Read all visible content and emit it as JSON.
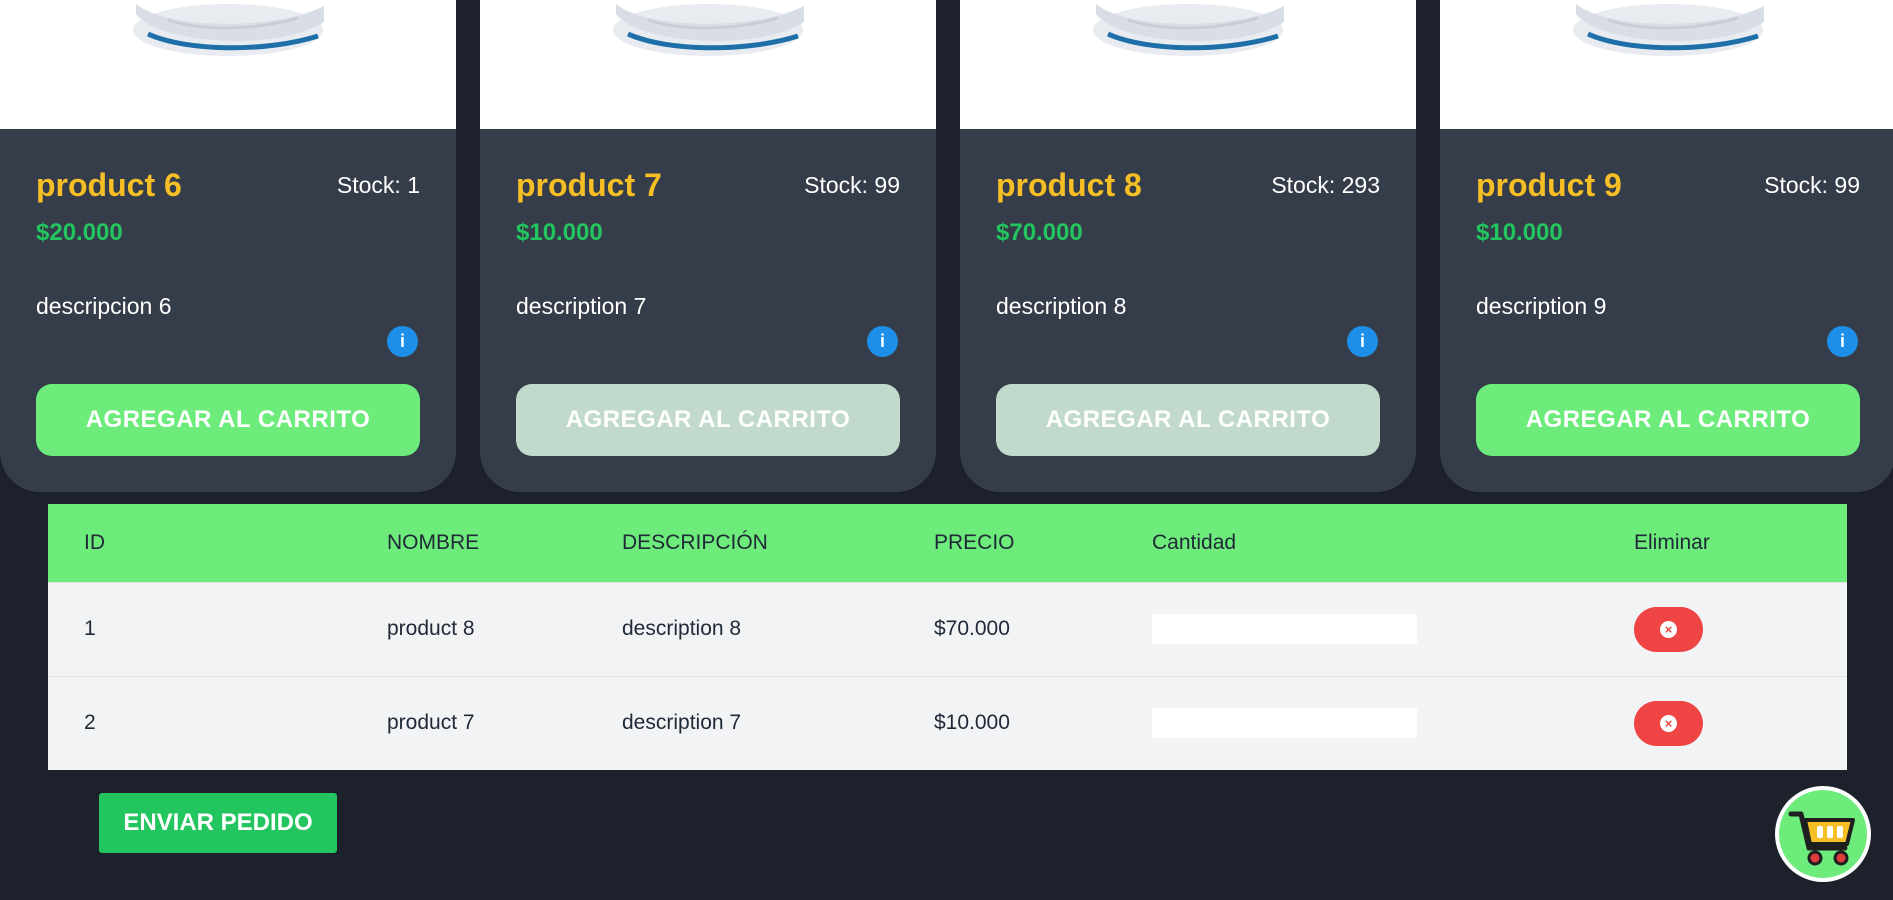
{
  "products": [
    {
      "title": "product 6",
      "stock": "Stock: 1",
      "price": "$20.000",
      "description": "descripcion 6",
      "button": "AGREGAR AL CARRITO",
      "disabled": false
    },
    {
      "title": "product 7",
      "stock": "Stock: 99",
      "price": "$10.000",
      "description": "description 7",
      "button": "AGREGAR AL CARRITO",
      "disabled": true
    },
    {
      "title": "product 8",
      "stock": "Stock: 293",
      "price": "$70.000",
      "description": "description 8",
      "button": "AGREGAR AL CARRITO",
      "disabled": true
    },
    {
      "title": "product 9",
      "stock": "Stock: 99",
      "price": "$10.000",
      "description": "description 9",
      "button": "AGREGAR AL CARRITO",
      "disabled": false
    }
  ],
  "info_icon": "i",
  "order_table": {
    "headers": [
      "ID",
      "NOMBRE",
      "DESCRIPCIÓN",
      "PRECIO",
      "Cantidad",
      "Eliminar"
    ],
    "rows": [
      {
        "id": "1",
        "name": "product 8",
        "description": "description 8",
        "price": "$70.000",
        "quantity": ""
      },
      {
        "id": "2",
        "name": "product 7",
        "description": "description 7",
        "price": "$10.000",
        "quantity": ""
      }
    ]
  },
  "send_button": "ENVIAR PEDIDO",
  "icons": {
    "product_image": "sneaker-image",
    "info": "info-icon",
    "delete": "x-circle-icon",
    "cart": "shopping-cart-icon"
  },
  "colors": {
    "background": "#1c212c",
    "card": "#363d4a",
    "title": "#f6bf25",
    "price": "#22c55e",
    "add_button": "#6deb7b",
    "add_button_disabled": "#c2dacb",
    "table_header": "#6deb7b",
    "delete_button": "#ef4444",
    "send_button": "#22c55e",
    "info_icon": "#1e8fe8"
  }
}
